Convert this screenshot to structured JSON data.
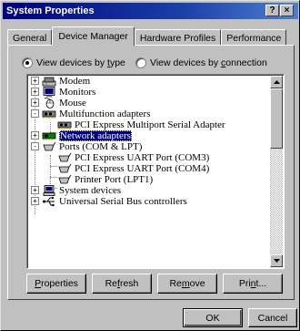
{
  "window": {
    "title": "System Properties",
    "help_glyph": "?",
    "close_glyph": "×"
  },
  "tabs": [
    {
      "label": "General",
      "active": false
    },
    {
      "label": "Device Manager",
      "active": true
    },
    {
      "label": "Hardware Profiles",
      "active": false
    },
    {
      "label": "Performance",
      "active": false
    }
  ],
  "view_options": {
    "by_type_prefix": "View devices by ",
    "by_type_key": "t",
    "by_type_suffix": "ype",
    "by_connection_prefix": "View devices by ",
    "by_connection_key": "c",
    "by_connection_suffix": "onnection",
    "selected": "by_type"
  },
  "devices": [
    {
      "label": "Modem",
      "icon": "modem-icon",
      "expander": "+",
      "level": 0
    },
    {
      "label": "Monitors",
      "icon": "monitor-icon",
      "expander": "+",
      "level": 0
    },
    {
      "label": "Mouse",
      "icon": "mouse-icon",
      "expander": "+",
      "level": 0
    },
    {
      "label": "Multifunction adapters",
      "icon": "multifunction-adapter-icon",
      "expander": "-",
      "level": 0
    },
    {
      "label": "PCI Express Multiport Serial Adapter",
      "icon": "serial-adapter-icon",
      "expander": "",
      "level": 1
    },
    {
      "label": "Network adapters",
      "icon": "network-adapter-icon",
      "expander": "+",
      "level": 0,
      "selected": true
    },
    {
      "label": "Ports (COM & LPT)",
      "icon": "port-connector-icon",
      "expander": "-",
      "level": 0
    },
    {
      "label": "PCI Express UART Port (COM3)",
      "icon": "port-connector-icon",
      "expander": "",
      "level": 1
    },
    {
      "label": "PCI Express UART Port (COM4)",
      "icon": "port-connector-icon",
      "expander": "",
      "level": 1
    },
    {
      "label": "Printer Port (LPT1)",
      "icon": "port-connector-icon",
      "expander": "",
      "level": 1
    },
    {
      "label": "System devices",
      "icon": "computer-icon",
      "expander": "+",
      "level": 0
    },
    {
      "label": "Universal Serial Bus controllers",
      "icon": "usb-icon",
      "expander": "+",
      "level": 0
    }
  ],
  "actions": {
    "properties_key": "P",
    "properties_rest": "roperties",
    "refresh_pre": "Re",
    "refresh_key": "f",
    "refresh_rest": "resh",
    "remove_pre": "Re",
    "remove_key": "m",
    "remove_rest": "ove",
    "print_pre": "Pri",
    "print_key": "n",
    "print_rest": "t..."
  },
  "dialog_buttons": {
    "ok": "OK",
    "cancel": "Cancel"
  }
}
